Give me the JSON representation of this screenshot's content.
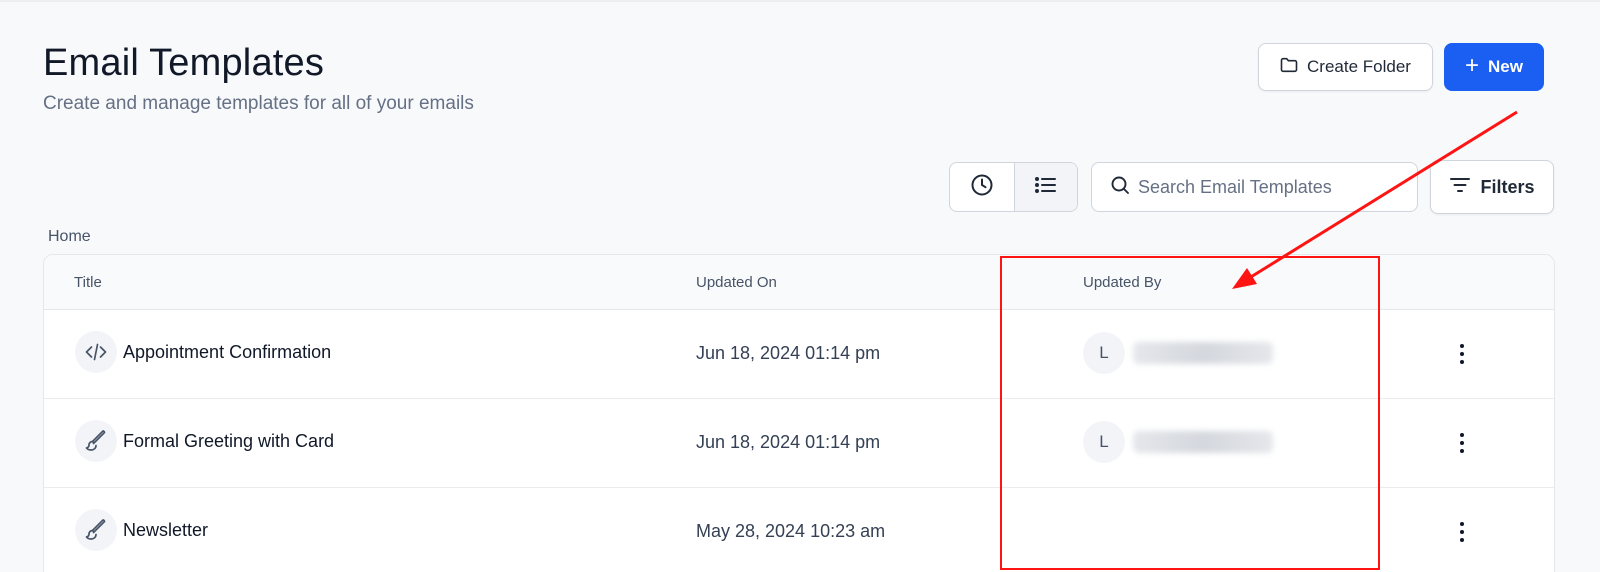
{
  "header": {
    "title": "Email Templates",
    "subtitle": "Create and manage templates for all of your emails",
    "create_folder_label": "Create Folder",
    "new_label": "New",
    "new_plus": "+"
  },
  "toolbar": {
    "search_placeholder": "Search Email Templates",
    "filters_label": "Filters"
  },
  "breadcrumb": {
    "home": "Home"
  },
  "table": {
    "headers": {
      "title": "Title",
      "updated_on": "Updated On",
      "updated_by": "Updated By"
    },
    "rows": [
      {
        "title": "Appointment Confirmation",
        "icon": "code-icon",
        "updated_on": "Jun 18, 2024 01:14 pm",
        "avatar": "L"
      },
      {
        "title": "Formal Greeting with Card",
        "icon": "brush-icon",
        "updated_on": "Jun 18, 2024 01:14 pm",
        "avatar": "L"
      },
      {
        "title": "Newsletter",
        "icon": "brush-icon",
        "updated_on": "May 28, 2024 10:23 am",
        "avatar": ""
      }
    ]
  },
  "colors": {
    "primary": "#1a5ff2",
    "annotation": "#ff1414",
    "border": "#d0d5dd"
  }
}
